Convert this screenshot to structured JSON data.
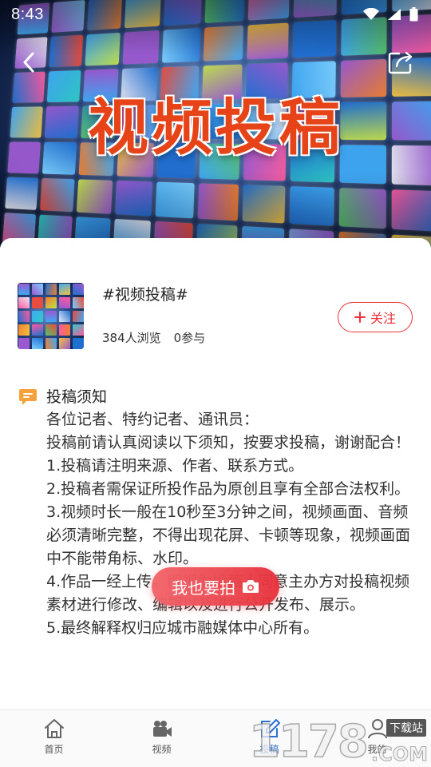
{
  "status_bar": {
    "time": "8:43"
  },
  "hero": {
    "title": "视频投稿"
  },
  "topic": {
    "title": "#视频投稿#",
    "views": "384人浏览",
    "participants": "0参与",
    "follow_label": "关注"
  },
  "notice": {
    "heading": "投稿须知",
    "lines": [
      "各位记者、特约记者、通讯员：",
      "投稿前请认真阅读以下须知，按要求投稿，谢谢配合！",
      "1.投稿请注明来源、作者、联系方式。",
      "2.投稿者需保证所投作品为原创且享有全部合法权利。",
      "3.视频时长一般在10秒至3分钟之间，视频画面、音频必须清晰完整，不得出现花屏、卡顿等现象，视频画面中不能带角标、水印。",
      "4.作品一经上传，即视为投稿人同意主办方对投稿视频素材进行修改、编辑以及进行公开发布、展示。",
      "5.最终解释权归应城市融媒体中心所有。"
    ]
  },
  "shoot_button": {
    "label": "我也要拍"
  },
  "tabbar": {
    "tabs": [
      {
        "label": "首页",
        "icon": "home-icon"
      },
      {
        "label": "视频",
        "icon": "video-camera-icon"
      },
      {
        "label": "投稿",
        "icon": "edit-icon",
        "active": true
      },
      {
        "label": "我的",
        "icon": "user-icon"
      }
    ]
  },
  "watermark": {
    "digits": "1178",
    "top_text": "下载站",
    "suffix": ".COM"
  },
  "colors": {
    "accent_red": "#e8323c",
    "title_orange": "#e64318",
    "notice_orange": "#f5a23c",
    "active_blue": "#2b6fd6"
  }
}
